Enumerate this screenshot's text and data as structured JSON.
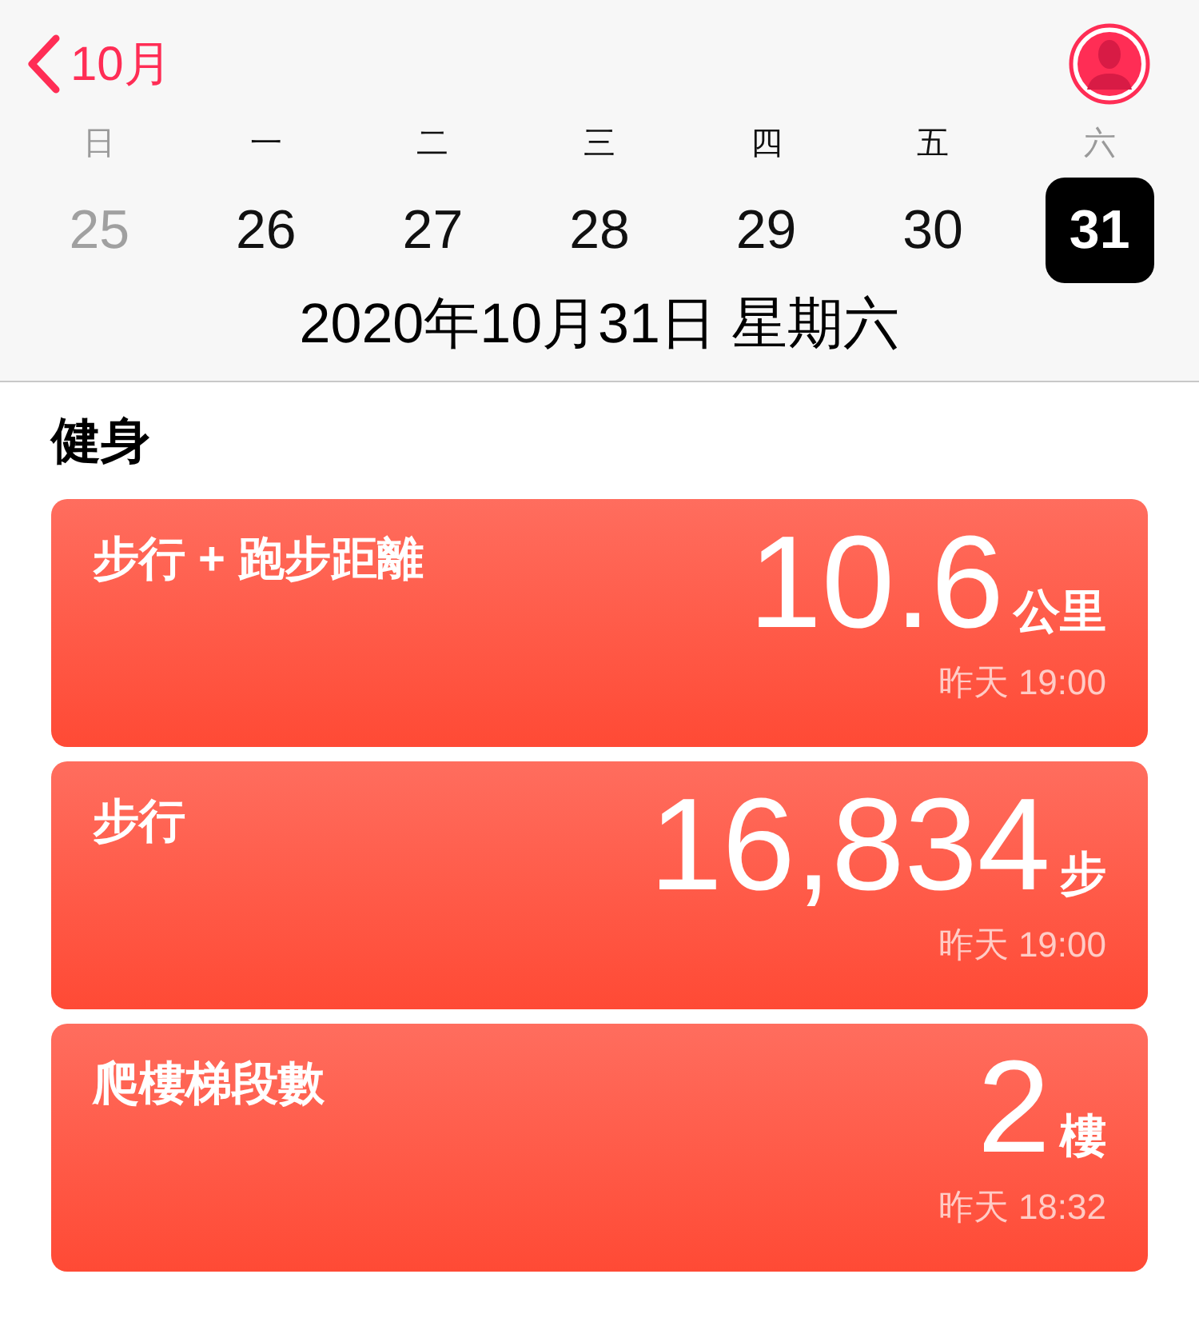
{
  "header": {
    "back_label": "10月",
    "date_line": "2020年10月31日 星期六"
  },
  "week": [
    {
      "weekday": "日",
      "date": "25",
      "dimmed": true,
      "selected": false
    },
    {
      "weekday": "一",
      "date": "26",
      "dimmed": false,
      "selected": false
    },
    {
      "weekday": "二",
      "date": "27",
      "dimmed": false,
      "selected": false
    },
    {
      "weekday": "三",
      "date": "28",
      "dimmed": false,
      "selected": false
    },
    {
      "weekday": "四",
      "date": "29",
      "dimmed": false,
      "selected": false
    },
    {
      "weekday": "五",
      "date": "30",
      "dimmed": false,
      "selected": false
    },
    {
      "weekday": "六",
      "date": "31",
      "dimmed": true,
      "selected": true
    }
  ],
  "section": {
    "title": "健身"
  },
  "cards": [
    {
      "title": "步行 + 跑步距離",
      "value": "10.6",
      "unit": "公里",
      "time": "昨天 19:00"
    },
    {
      "title": "步行",
      "value": "16,834",
      "unit": "步",
      "time": "昨天 19:00"
    },
    {
      "title": "爬樓梯段數",
      "value": "2",
      "unit": "樓",
      "time": "昨天 18:32"
    }
  ]
}
